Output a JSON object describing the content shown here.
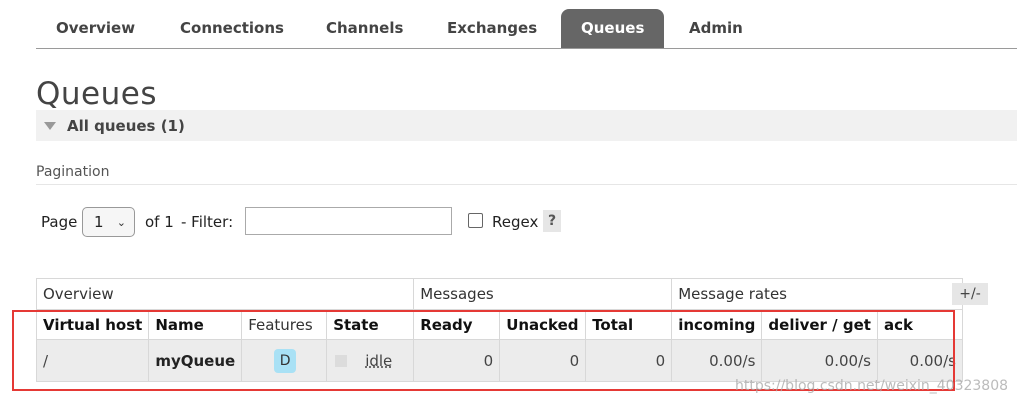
{
  "nav": {
    "tabs": [
      {
        "label": "Overview",
        "active": false
      },
      {
        "label": "Connections",
        "active": false
      },
      {
        "label": "Channels",
        "active": false
      },
      {
        "label": "Exchanges",
        "active": false
      },
      {
        "label": "Queues",
        "active": true
      },
      {
        "label": "Admin",
        "active": false
      }
    ]
  },
  "page": {
    "title": "Queues",
    "section_label": "All queues (1)"
  },
  "pagination": {
    "label": "Pagination",
    "page_label": "Page",
    "page_value": "1",
    "of_label": "of 1",
    "filter_label": "- Filter:",
    "filter_value": "",
    "regex_label": "Regex",
    "regex_checked": false,
    "help_label": "?"
  },
  "table": {
    "groups": [
      "Overview",
      "Messages",
      "Message rates"
    ],
    "columns": [
      "Virtual host",
      "Name",
      "Features",
      "State",
      "Ready",
      "Unacked",
      "Total",
      "incoming",
      "deliver / get",
      "ack"
    ],
    "rows": [
      {
        "virtual_host": "/",
        "name": "myQueue",
        "feature": "D",
        "state": "idle",
        "ready": "0",
        "unacked": "0",
        "total": "0",
        "incoming": "0.00/s",
        "deliver_get": "0.00/s",
        "ack": "0.00/s"
      }
    ],
    "toggle_label": "+/-"
  },
  "watermark": "https://blog.csdn.net/weixin_40323808",
  "colors": {
    "active_tab": "#666666",
    "highlight": "#e53935",
    "feature_badge": "#a9e1f5"
  }
}
